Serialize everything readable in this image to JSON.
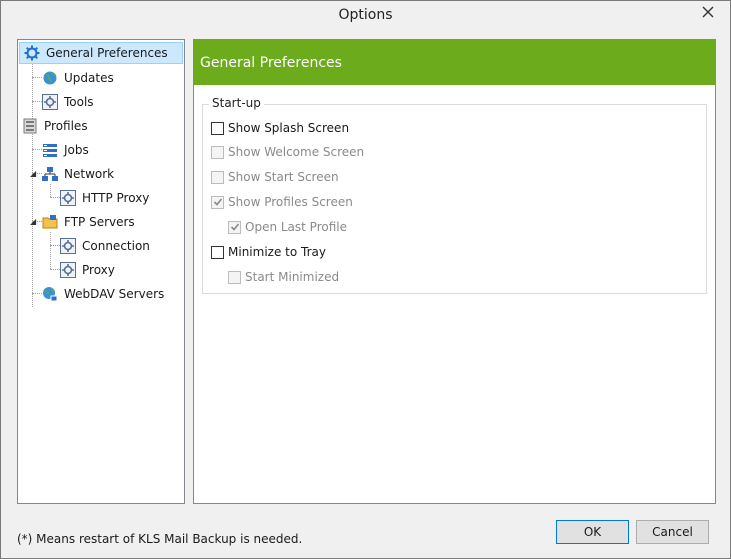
{
  "window": {
    "title": "Options"
  },
  "tree": {
    "items": [
      {
        "label": "General Preferences",
        "icon": "gear-icon"
      },
      {
        "label": "Updates",
        "icon": "globe-icon"
      },
      {
        "label": "Tools",
        "icon": "tools-icon"
      },
      {
        "label": "Profiles",
        "icon": "profiles-icon"
      },
      {
        "label": "Jobs",
        "icon": "jobs-icon"
      },
      {
        "label": "Network",
        "icon": "network-icon"
      },
      {
        "label": "HTTP Proxy",
        "icon": "settings-icon"
      },
      {
        "label": "FTP Servers",
        "icon": "ftp-icon"
      },
      {
        "label": "Connection",
        "icon": "settings-icon"
      },
      {
        "label": "Proxy",
        "icon": "settings-icon"
      },
      {
        "label": "WebDAV Servers",
        "icon": "webdav-icon"
      }
    ]
  },
  "panel": {
    "header": "General Preferences",
    "group_title": "Start-up",
    "options": [
      {
        "label": "Show Splash Screen",
        "checked": false,
        "enabled": true
      },
      {
        "label": "Show Welcome Screen",
        "checked": false,
        "enabled": false
      },
      {
        "label": "Show Start Screen",
        "checked": false,
        "enabled": false
      },
      {
        "label": "Show Profiles Screen",
        "checked": true,
        "enabled": false
      },
      {
        "label": "Open Last Profile",
        "checked": true,
        "enabled": false
      },
      {
        "label": "Minimize to Tray",
        "checked": false,
        "enabled": true
      },
      {
        "label": "Start Minimized",
        "checked": false,
        "enabled": false
      }
    ]
  },
  "footer": {
    "note": "(*) Means restart of KLS Mail Backup is needed.",
    "ok_label": "OK",
    "cancel_label": "Cancel"
  },
  "colors": {
    "header_green": "#6cac1c",
    "selection": "#cce8ff"
  }
}
